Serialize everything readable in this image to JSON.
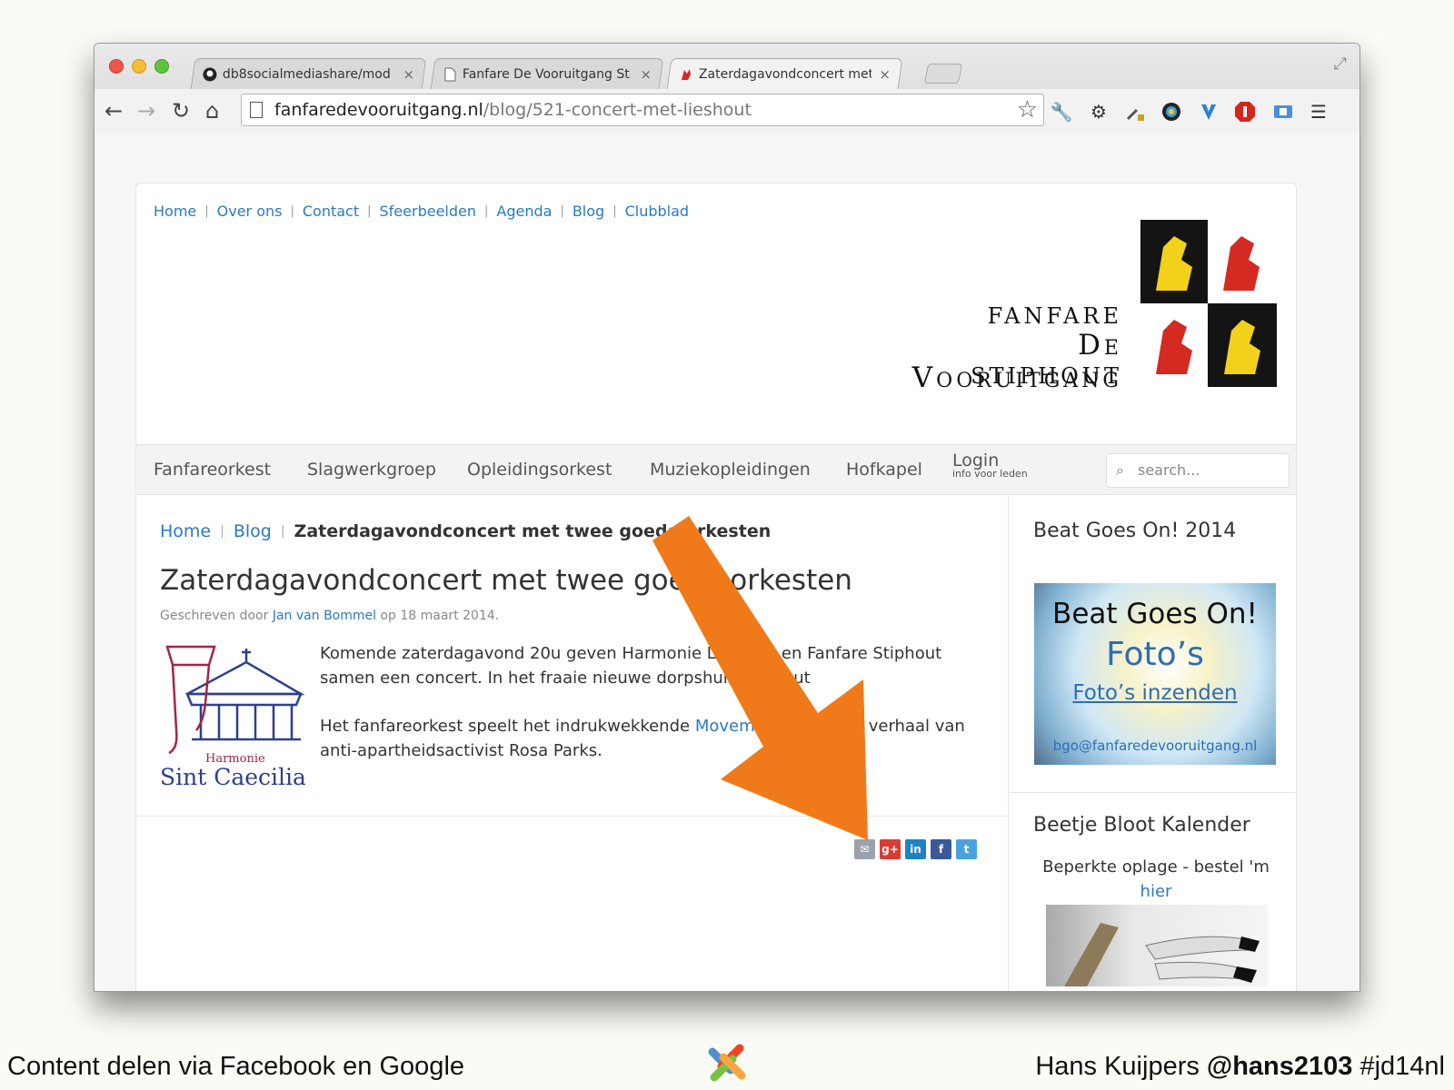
{
  "browser": {
    "tabs": [
      {
        "label": "db8socialmediashare/mod",
        "active": false
      },
      {
        "label": "Fanfare De Vooruitgang St",
        "active": false
      },
      {
        "label": "Zaterdagavondconcert met",
        "active": true
      }
    ],
    "close_glyph": "×",
    "url_host": "fanfaredevooruitgang.nl",
    "url_path": "/blog/521-concert-met-lieshout"
  },
  "site": {
    "top_nav": [
      "Home",
      "Over ons",
      "Contact",
      "Sfeerbeelden",
      "Agenda",
      "Blog",
      "Clubblad"
    ],
    "logo": {
      "line1": "FANFARE",
      "line2": "De Vooruitgang",
      "line3": "STIPHOUT"
    },
    "main_nav": [
      "Fanfareorkest",
      "Slagwerkgroep",
      "Opleidingsorkest",
      "Muziekopleidingen",
      "Hofkapel"
    ],
    "login": {
      "label": "Login",
      "sub": "info voor leden"
    },
    "search_placeholder": "search..."
  },
  "article": {
    "breadcrumb": {
      "home": "Home",
      "blog": "Blog",
      "current": "Zaterdagavondconcert met twee goede orkesten"
    },
    "title": "Zaterdagavondconcert met twee goede orkesten",
    "byline": {
      "prefix": "Geschreven door",
      "author": "Jan van Bommel",
      "suffix": "op 18 maart 2014."
    },
    "image_caption": {
      "line1": "Harmonie",
      "line2": "Sint Caecilia"
    },
    "paragraph1": "Komende zaterdagavond 20u geven Harmonie Lieshout en Fanfare Stiphout samen een concert. In het fraaie nieuwe dorpshuis Stiphout",
    "paragraph2_pre": "Het fanfareorkest speelt het indrukwekkende",
    "paragraph2_link": "Movement Rosa",
    "paragraph2_post": ", het verhaal van anti-apartheidsactivist Rosa Parks.",
    "share_icons": [
      "email-icon",
      "google-plus-icon",
      "linkedin-icon",
      "facebook-icon",
      "twitter-icon"
    ],
    "share_labels": {
      "email": "✉",
      "google": "g+",
      "linkedin": "in",
      "facebook": "f",
      "twitter": "t"
    }
  },
  "sidebar": {
    "bgo_heading": "Beat Goes On! 2014",
    "bgo_banner": {
      "line1": "Beat Goes On!",
      "line2": "Foto’s",
      "line3": "Foto’s inzenden",
      "line4": "bgo@fanfaredevooruitgang.nl"
    },
    "bbk_heading": "Beetje Bloot Kalender",
    "bbk_text": "Beperkte oplage - bestel 'm",
    "bbk_link": "hier"
  },
  "slide": {
    "footer_left": "Content delen via Facebook en Google",
    "footer_right_name": "Hans Kuijpers",
    "footer_right_handle": "@hans2103",
    "footer_right_tag": "#jd14nl"
  },
  "colors": {
    "accent_arrow": "#f07a1a",
    "link": "#2b78c5"
  }
}
